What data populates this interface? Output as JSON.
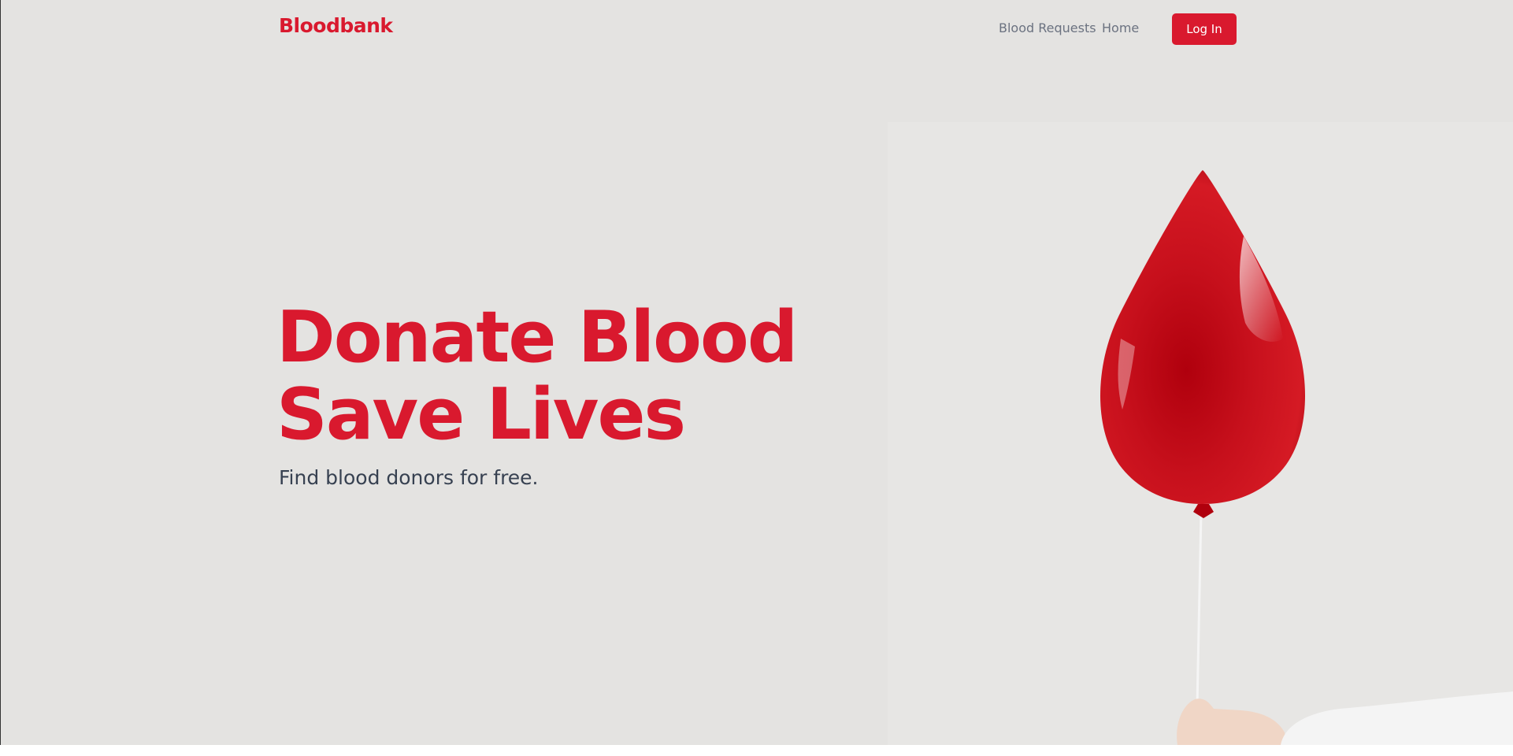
{
  "navbar": {
    "brand": "Bloodbank",
    "links": [
      {
        "label": "Blood Requests"
      },
      {
        "label": "Home"
      }
    ],
    "login_label": "Log In"
  },
  "hero": {
    "headline_line1": "Donate Blood",
    "headline_line2": "Save Lives",
    "subheadline": "Find blood donors for free."
  },
  "theme": {
    "accent": "#d9192e",
    "background": "#e4e3e1",
    "nav_text": "#6b7280",
    "body_text": "#374151"
  }
}
